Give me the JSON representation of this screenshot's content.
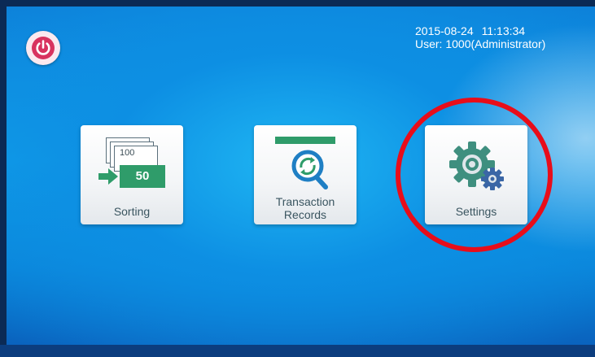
{
  "status": {
    "date": "2015-08-24",
    "time": "11:13:34",
    "user": "User: 1000(Administrator)"
  },
  "power_button": {
    "icon": "power-icon"
  },
  "tiles": [
    {
      "label": "Sorting",
      "icon": "sorting-icon",
      "bill_back": "100",
      "bill_front": "50"
    },
    {
      "label_line1": "Transaction",
      "label_line2": "Records",
      "icon": "transaction-search-icon"
    },
    {
      "label": "Settings",
      "icon": "gear-icon"
    }
  ],
  "colors": {
    "accent_green": "#2f9c6a",
    "power_pink": "#d8335f",
    "highlight_red": "#e80d1a"
  }
}
